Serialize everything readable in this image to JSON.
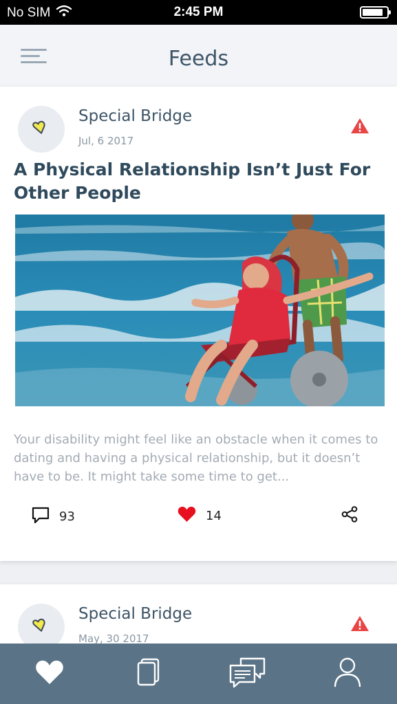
{
  "status_bar": {
    "carrier": "No SIM",
    "time": "2:45 PM",
    "battery_level": 0.85
  },
  "header": {
    "title": "Feeds",
    "menu_icon": "hamburger-menu-icon"
  },
  "feed": [
    {
      "author": "Special Bridge",
      "date": "Jul, 6 2017",
      "title": "A Physical Relationship Isn’t Just For Other People",
      "excerpt": "Your disability might feel like an obstacle when it comes to dating and having a physical relationship, but it doesn’t have to be. It might take some time to get...",
      "comments": "93",
      "likes": "14"
    },
    {
      "author": "Special Bridge",
      "date": "May, 30 2017"
    }
  ],
  "colors": {
    "header_bg": "#f2f4f7",
    "title": "#3d5466",
    "alert": "#e84545",
    "like": "#e8101f",
    "tabbar": "#5a7387"
  },
  "tabs": [
    {
      "icon": "heart-icon"
    },
    {
      "icon": "cards-icon"
    },
    {
      "icon": "chat-icon"
    },
    {
      "icon": "profile-icon"
    }
  ]
}
